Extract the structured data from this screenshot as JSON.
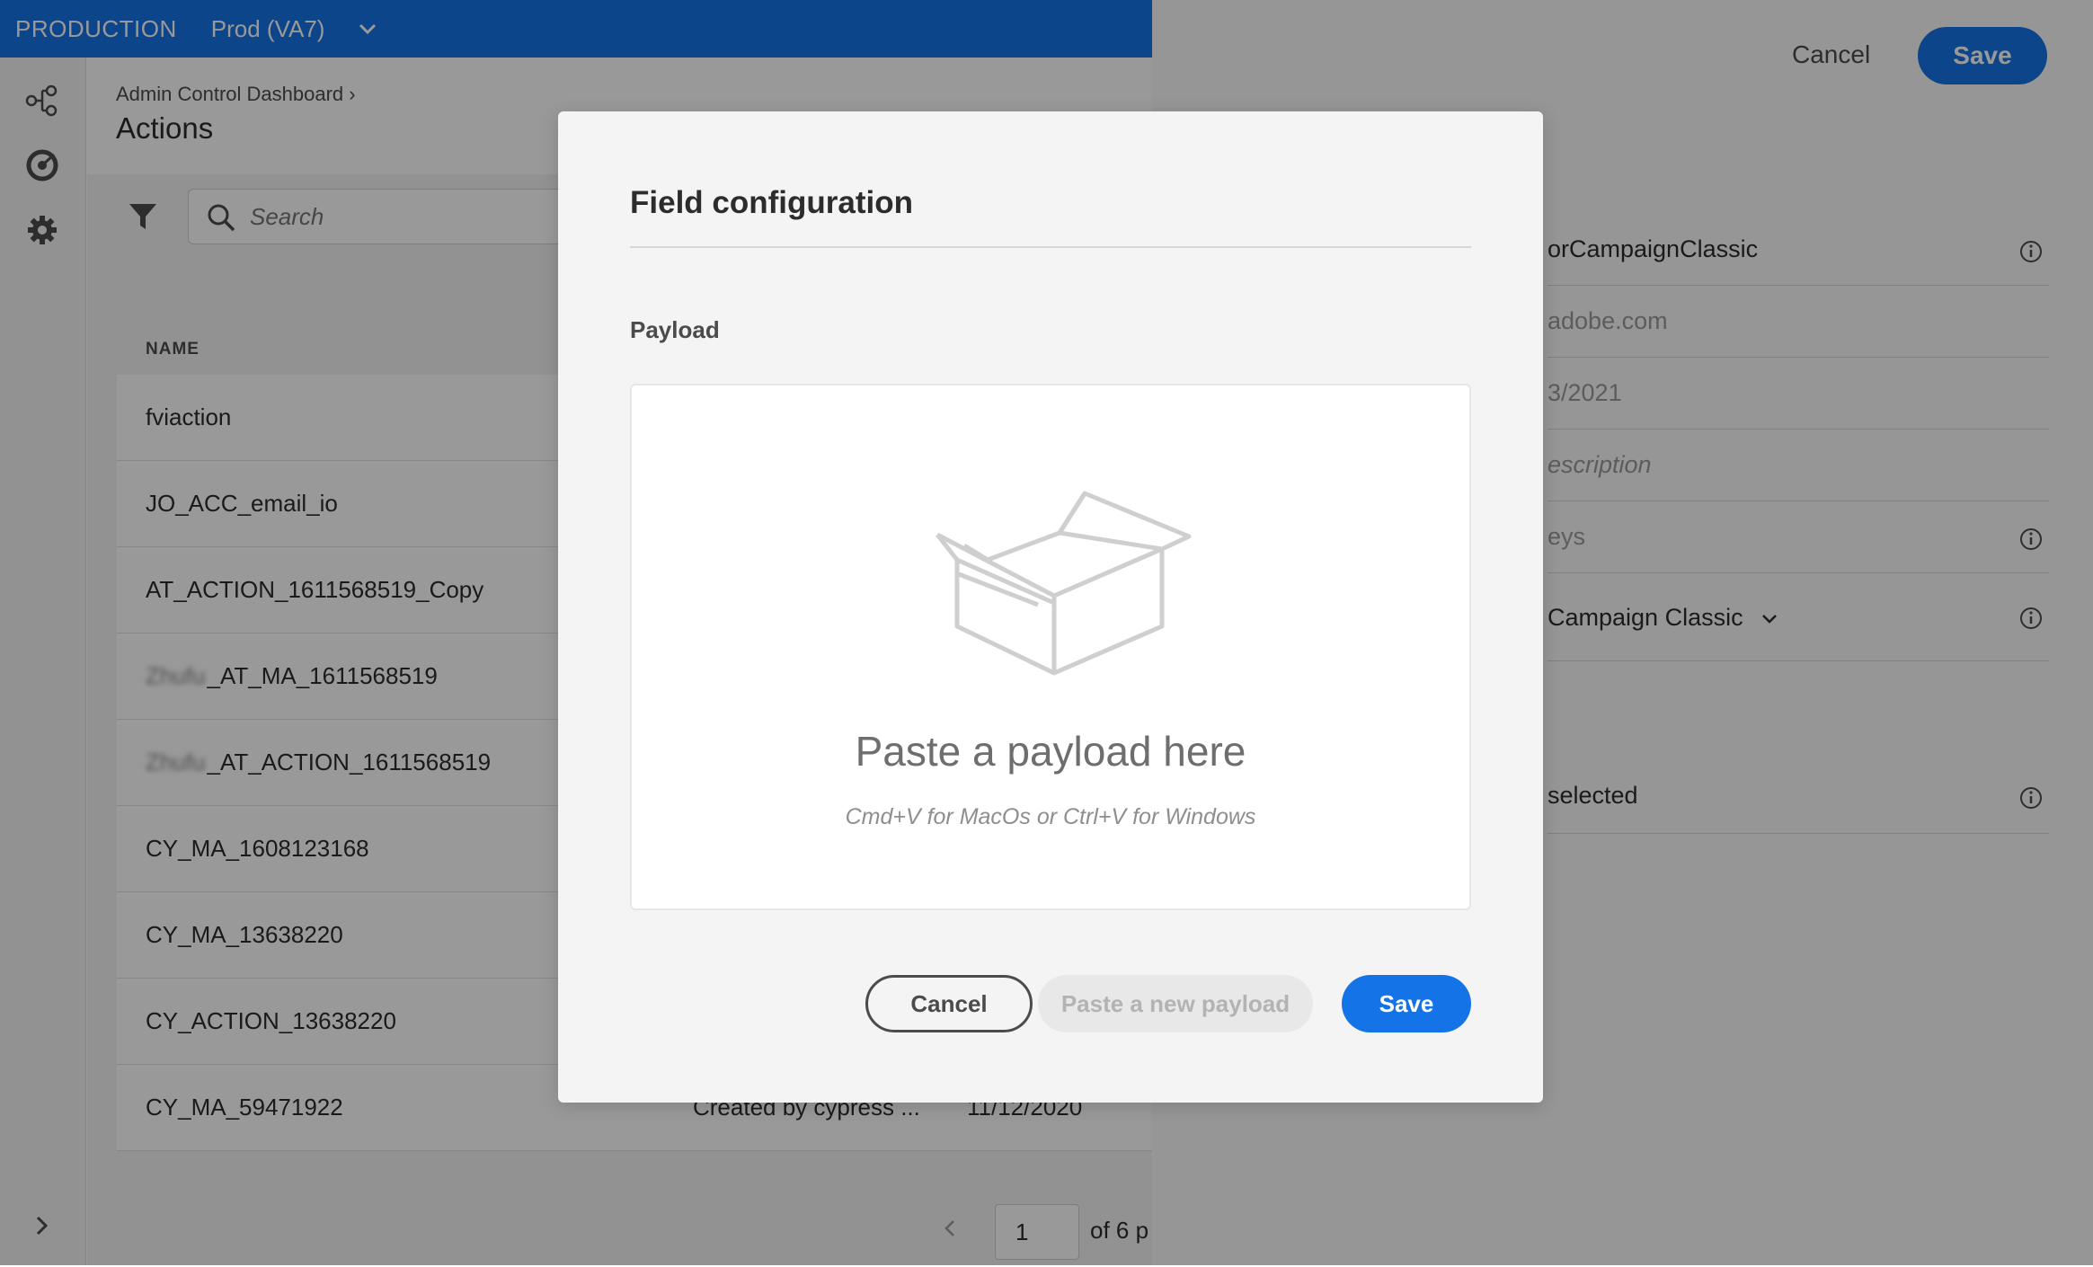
{
  "topbar": {
    "environment": "PRODUCTION",
    "sandbox": "Prod (VA7)",
    "chevron_icon": "chevron-down-icon",
    "color": "#1473e6"
  },
  "rail": {
    "icons": [
      "journeys-icon",
      "dashboard-icon",
      "gear-icon"
    ],
    "expand_icon": "chevron-right-icon"
  },
  "header": {
    "breadcrumb": "Admin Control Dashboard",
    "breadcrumb_separator": "›",
    "title": "Actions"
  },
  "search": {
    "placeholder": "Search"
  },
  "table": {
    "column_name": "NAME",
    "rows": [
      {
        "name": "fviaction",
        "desc": "",
        "date": ""
      },
      {
        "name": "JO_ACC_email_io",
        "desc": "",
        "date": ""
      },
      {
        "name": "AT_ACTION_1611568519_Copy",
        "desc": "",
        "date": ""
      },
      {
        "blurred": "Zhufu",
        "name": "_AT_MA_1611568519",
        "desc": "",
        "date": ""
      },
      {
        "blurred": "Zhufu",
        "name": "_AT_ACTION_1611568519",
        "desc": "",
        "date": ""
      },
      {
        "name": "CY_MA_1608123168",
        "desc": "",
        "date": ""
      },
      {
        "name": "CY_MA_13638220",
        "desc": "",
        "date": ""
      },
      {
        "name": "CY_ACTION_13638220",
        "desc": "",
        "date": ""
      },
      {
        "name": "CY_MA_59471922",
        "desc": "Created by cypress ...",
        "date": "11/12/2020"
      }
    ]
  },
  "pager": {
    "page": "1",
    "of_text": "of 6 p"
  },
  "side_panel": {
    "cancel_label": "Cancel",
    "save_label": "Save",
    "fields": [
      {
        "value": "orCampaignClassic",
        "info": true,
        "muted": false
      },
      {
        "value": "adobe.com",
        "info": false,
        "muted": true
      },
      {
        "value": "3/2021",
        "info": false,
        "muted": true
      },
      {
        "value": "escription",
        "info": false,
        "muted": true,
        "italic": true
      },
      {
        "value": "eys",
        "info": true,
        "muted": true
      },
      {
        "value": "Campaign Classic",
        "info": true,
        "muted": false,
        "dropdown": true
      },
      {
        "value": "selected",
        "info": true,
        "muted": false
      }
    ]
  },
  "modal": {
    "title": "Field configuration",
    "payload_label": "Payload",
    "dropzone_title": "Paste a payload here",
    "dropzone_hint": "Cmd+V for MacOs or Ctrl+V for Windows",
    "illustration_icon": "open-box-icon",
    "cancel_label": "Cancel",
    "paste_new_label": "Paste a new payload",
    "save_label": "Save"
  }
}
